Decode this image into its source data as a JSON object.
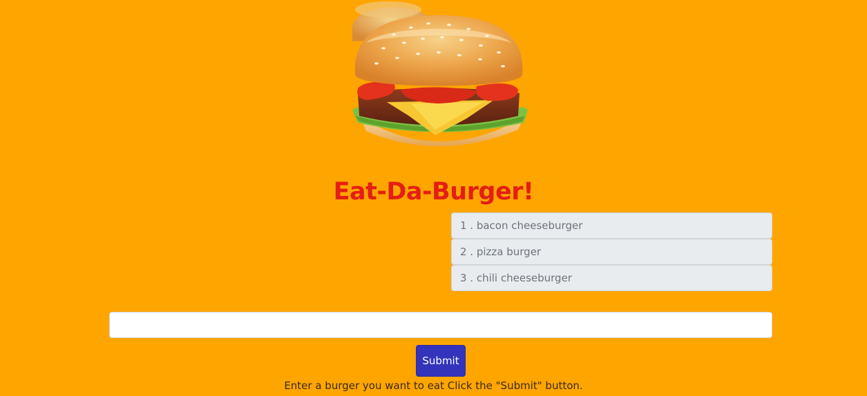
{
  "header": {
    "logo_icon": "hamburger-image",
    "title": "Eat-Da-Burger!"
  },
  "burgers": {
    "items": [
      {
        "label": "1 . bacon cheeseburger"
      },
      {
        "label": "2 . pizza burger"
      },
      {
        "label": "3 . chili cheeseburger"
      }
    ]
  },
  "form": {
    "input_value": "",
    "submit_label": "Submit",
    "instructions": "Enter a burger you want to eat Click the \"Submit\" button."
  },
  "colors": {
    "background": "#FFA500",
    "title": "#E41E13",
    "button": "#3333BB",
    "list_item": "#E9ECEF"
  }
}
